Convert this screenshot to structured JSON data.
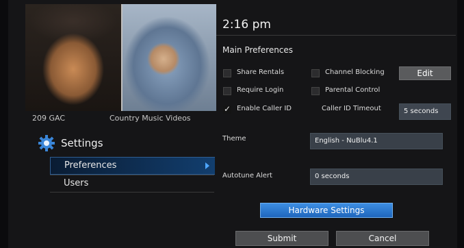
{
  "video": {
    "channel_number": "209",
    "channel_name": "GAC",
    "program_title": "Country Music Videos"
  },
  "menu": {
    "title": "Settings",
    "items": [
      {
        "label": "Preferences",
        "selected": true
      },
      {
        "label": "Users",
        "selected": false
      }
    ]
  },
  "header": {
    "time": "2:16 pm"
  },
  "main_preferences": {
    "title": "Main Preferences",
    "checkboxes": [
      {
        "label": "Share Rentals",
        "checked": false
      },
      {
        "label": "Channel Blocking",
        "checked": false
      },
      {
        "label": "Require Login",
        "checked": false
      },
      {
        "label": "Parental Control",
        "checked": false
      },
      {
        "label": "Enable Caller ID",
        "checked": true
      }
    ],
    "edit_label": "Edit",
    "caller_id_timeout": {
      "label": "Caller ID Timeout",
      "value": "5 seconds"
    }
  },
  "theme": {
    "label": "Theme",
    "value": "English - NuBlu4.1"
  },
  "autotune": {
    "label": "Autotune Alert",
    "value": "0 seconds"
  },
  "buttons": {
    "hardware": "Hardware Settings",
    "submit": "Submit",
    "cancel": "Cancel"
  },
  "colors": {
    "accent_blue": "#2a7bd2",
    "field_bg": "#394049",
    "panel_bg": "#151517"
  },
  "icons": [
    "gear-icon",
    "chevron-right-icon",
    "checkmark-icon"
  ]
}
